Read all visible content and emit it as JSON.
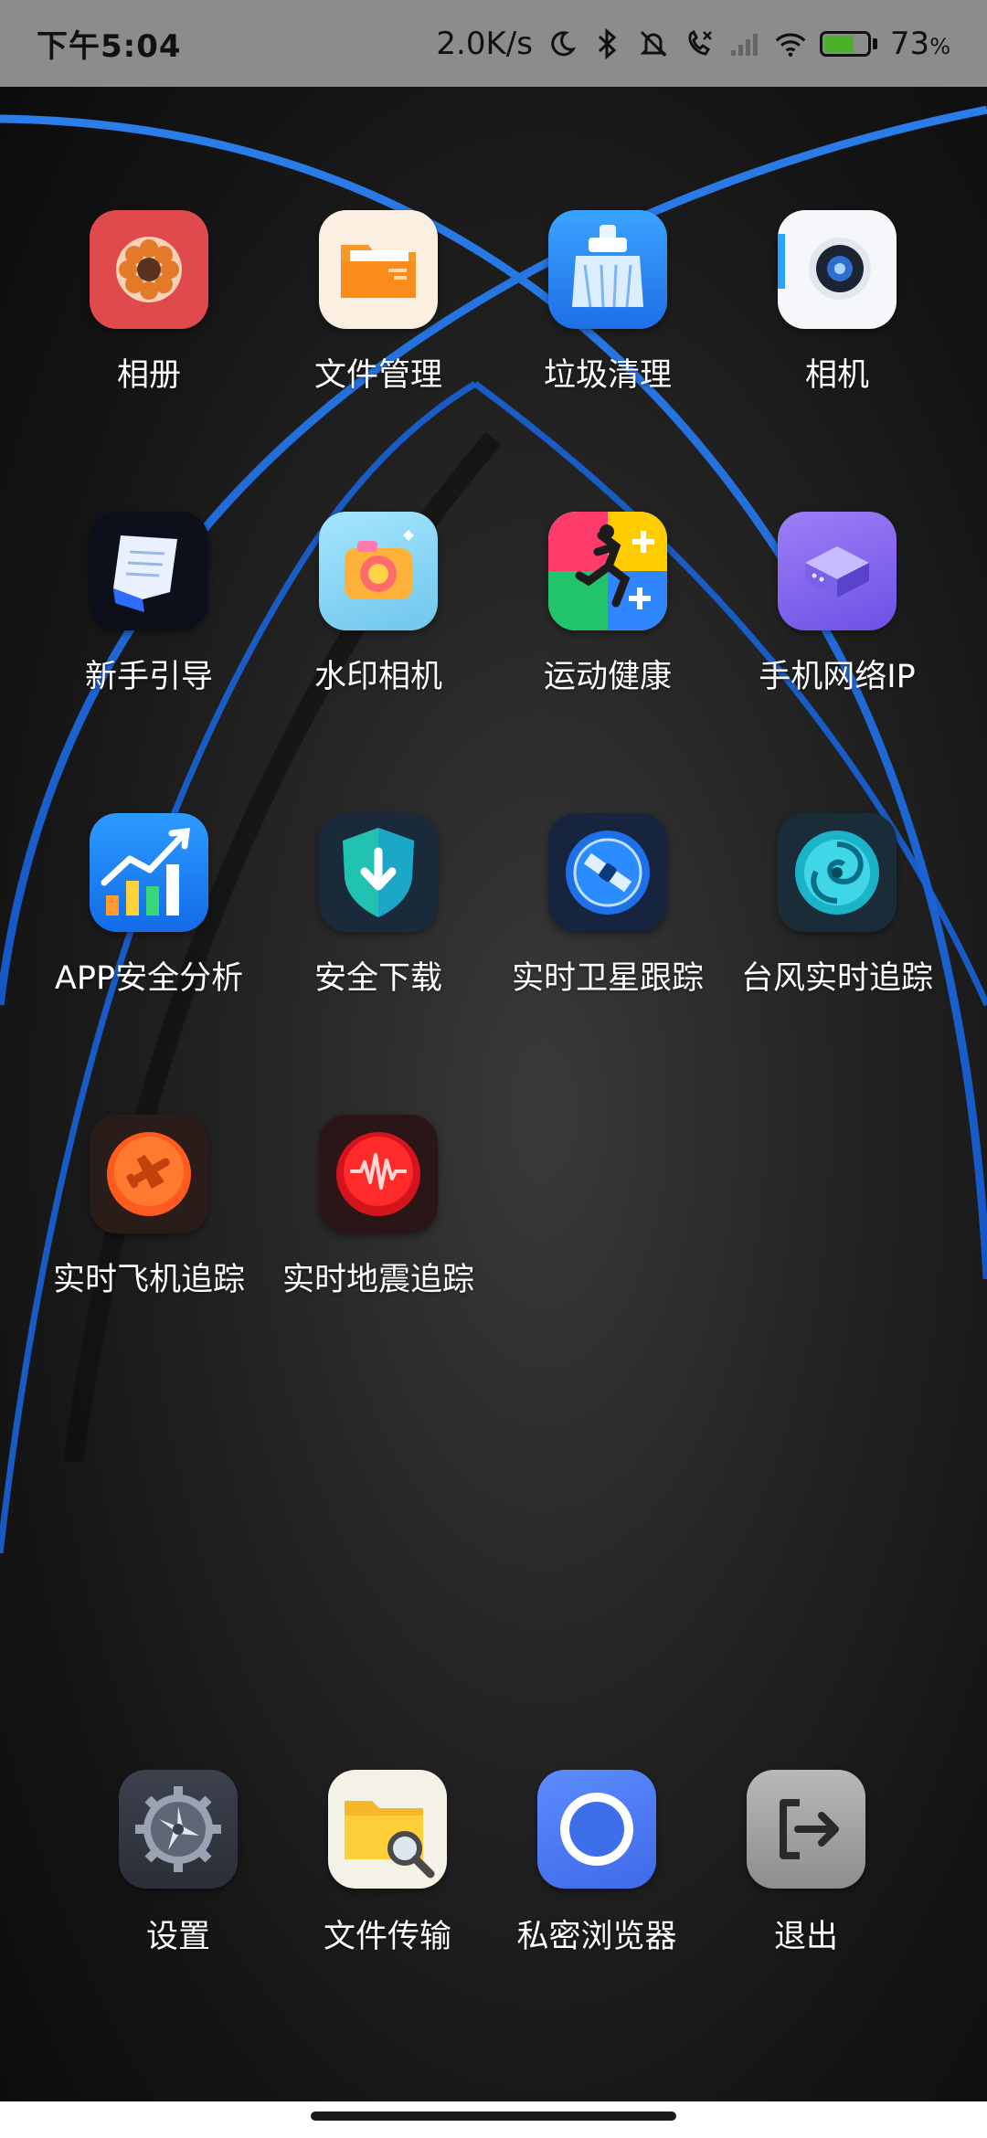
{
  "status_bar": {
    "time": "下午5:04",
    "net_speed": "2.0K/s",
    "battery_percent": "73",
    "battery_suffix": "%",
    "battery_level": 0.73,
    "icons": [
      "moon-icon",
      "bluetooth-icon",
      "mute-bell-icon",
      "call-forward-icon",
      "signal-icon",
      "wifi-icon",
      "battery-icon"
    ]
  },
  "apps": [
    {
      "label": "相册",
      "icon": "gallery-icon",
      "bg": "#e04a4d"
    },
    {
      "label": "文件管理",
      "icon": "folder-icon",
      "bg": "#fbefe2"
    },
    {
      "label": "垃圾清理",
      "icon": "broom-icon",
      "bg": "#2f8ef8"
    },
    {
      "label": "相机",
      "icon": "camera-icon",
      "bg": "#f5f7fa"
    },
    {
      "label": "新手引导",
      "icon": "scroll-icon",
      "bg": "#0d0f1a"
    },
    {
      "label": "水印相机",
      "icon": "watermark-camera-icon",
      "bg": "#8ad6f2"
    },
    {
      "label": "运动健康",
      "icon": "running-person-icon",
      "bg": "#ffffff"
    },
    {
      "label": "手机网络IP",
      "icon": "router-icon",
      "bg": "#8b6cf0"
    },
    {
      "label": "APP安全分析",
      "icon": "bar-chart-icon",
      "bg": "#1b86f0"
    },
    {
      "label": "安全下载",
      "icon": "shield-download-icon",
      "bg": "#1b2a3a"
    },
    {
      "label": "实时卫星跟踪",
      "icon": "satellite-icon",
      "bg": "#16243e"
    },
    {
      "label": "台风实时追踪",
      "icon": "typhoon-icon",
      "bg": "#1a2c38"
    },
    {
      "label": "实时飞机追踪",
      "icon": "airplane-icon",
      "bg": "#2a1c18"
    },
    {
      "label": "实时地震追踪",
      "icon": "seismograph-icon",
      "bg": "#2a1616"
    }
  ],
  "dock": [
    {
      "label": "设置",
      "icon": "gear-icon",
      "bg": "#3a3f4a"
    },
    {
      "label": "文件传输",
      "icon": "folder-search-icon",
      "bg": "#f4f1e6"
    },
    {
      "label": "私密浏览器",
      "icon": "browser-icon",
      "bg": "#4e7df0"
    },
    {
      "label": "退出",
      "icon": "exit-icon",
      "bg": "#a7a7a7"
    }
  ]
}
